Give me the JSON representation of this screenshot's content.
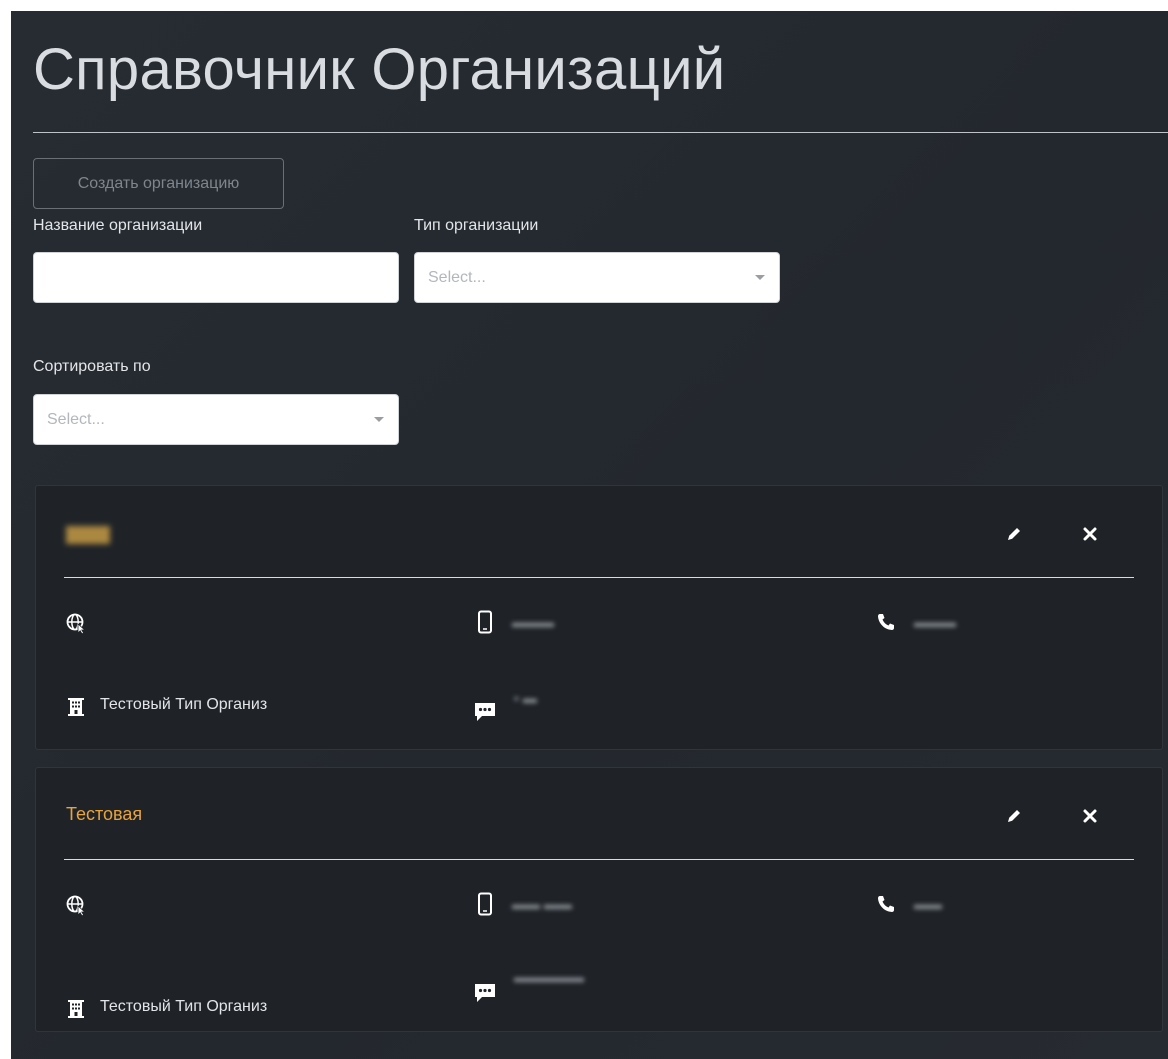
{
  "header": {
    "title": "Справочник Организаций"
  },
  "toolbar": {
    "create_label": "Создать организацию"
  },
  "filters": {
    "name_label": "Название организации",
    "name_value": "",
    "type_label": "Тип организации",
    "type_placeholder": "Select...",
    "sort_label": "Сортировать по",
    "sort_placeholder": "Select..."
  },
  "organizations": [
    {
      "name": "",
      "name_obscured": true,
      "type": "Тестовый Тип Организ",
      "website": "",
      "mobile": "",
      "phone": "",
      "message": "",
      "details_obscured": true
    },
    {
      "name": "Тестовая",
      "name_obscured": false,
      "type": "Тестовый Тип Организ",
      "website": "",
      "mobile": "",
      "phone": "",
      "message": "",
      "details_obscured": true
    }
  ],
  "icons": {
    "website": "globe-pointer-icon",
    "mobile": "mobile-phone-icon",
    "phone": "phone-icon",
    "type": "building-icon",
    "message": "chat-bubble-icon",
    "edit": "pencil-icon",
    "delete": "close-icon"
  },
  "colors": {
    "background": "#262b31",
    "card": "#1f2328",
    "accent_title": "#e8a43c",
    "text": "#e3e5e8"
  }
}
